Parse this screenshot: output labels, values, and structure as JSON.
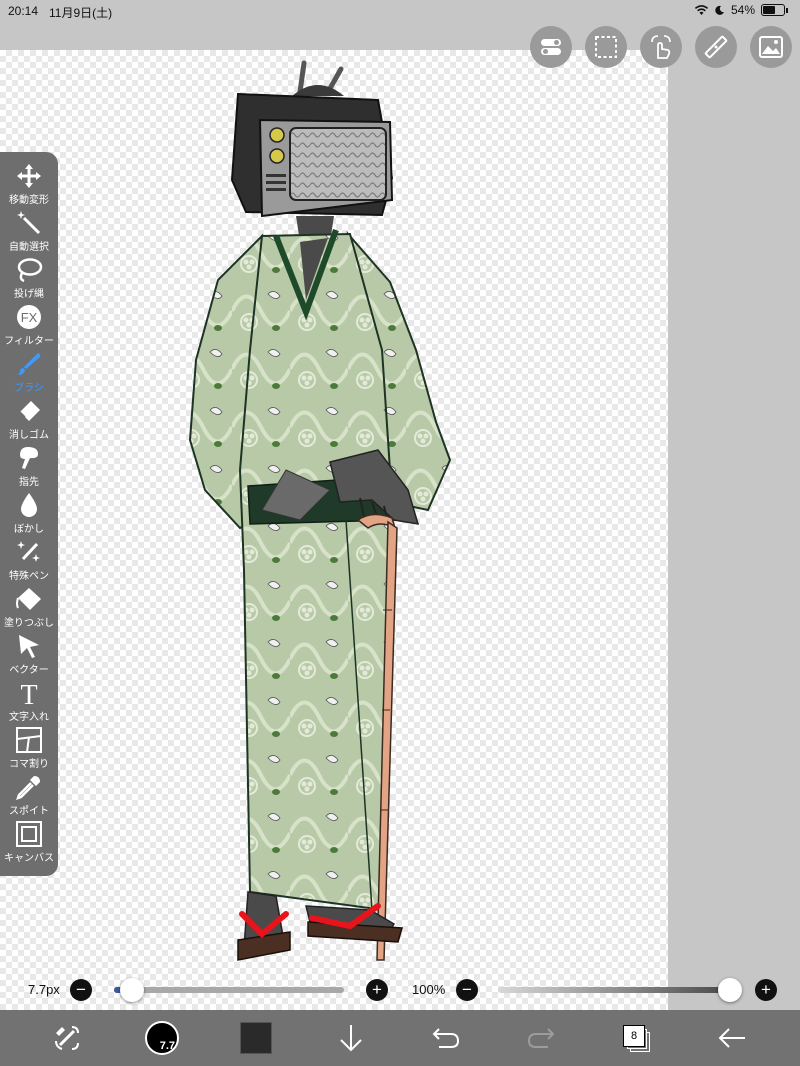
{
  "status_bar": {
    "time": "20:14",
    "date": "11月9日(土)",
    "battery": "54%"
  },
  "top_tools": [
    "toggle-icon",
    "selection-icon",
    "gesture-icon",
    "ruler-icon",
    "image-icon"
  ],
  "left_toolbar": {
    "items": [
      {
        "label": "移動変形",
        "icon": "move-icon",
        "active": false
      },
      {
        "label": "自動選択",
        "icon": "magic-wand-icon",
        "active": false
      },
      {
        "label": "投げ縄",
        "icon": "lasso-icon",
        "active": false
      },
      {
        "label": "フィルター",
        "icon": "fx-icon",
        "active": false
      },
      {
        "label": "ブラシ",
        "icon": "brush-icon",
        "active": true
      },
      {
        "label": "消しゴム",
        "icon": "eraser-icon",
        "active": false
      },
      {
        "label": "指先",
        "icon": "finger-icon",
        "active": false
      },
      {
        "label": "ぼかし",
        "icon": "blur-icon",
        "active": false
      },
      {
        "label": "特殊ペン",
        "icon": "special-pen-icon",
        "active": false
      },
      {
        "label": "塗りつぶし",
        "icon": "fill-icon",
        "active": false
      },
      {
        "label": "ベクター",
        "icon": "vector-icon",
        "active": false
      },
      {
        "label": "文字入れ",
        "icon": "text-icon",
        "active": false
      },
      {
        "label": "コマ割り",
        "icon": "frame-icon",
        "active": false
      },
      {
        "label": "スポイト",
        "icon": "eyedropper-icon",
        "active": false
      },
      {
        "label": "キャンバス",
        "icon": "canvas-icon",
        "active": false
      }
    ]
  },
  "sliders": {
    "brush_size": {
      "label": "7.7px",
      "minus": "−",
      "plus": "+",
      "fraction": 0.05
    },
    "opacity": {
      "label": "100%",
      "minus": "−",
      "plus": "+",
      "fraction": 1.0
    }
  },
  "bottom_bar": {
    "brush_size_badge": "7.7",
    "color": "#2a2a2a",
    "layer_count": "8",
    "icons": [
      "transform-icon",
      "brush-size-icon",
      "color-swatch-icon",
      "download-icon",
      "undo-icon",
      "redo-icon",
      "layers-icon",
      "back-arrow-icon"
    ]
  },
  "colors": {
    "ui_gray": "#c6c6c6",
    "toolbar_gray": "#6e6e6e",
    "bottom_gray": "#727272",
    "accent_blue": "#3d9bff",
    "kimono_green": "#b4c6a4",
    "geta_red": "#e8141c",
    "cane_peach": "#e2a484"
  }
}
